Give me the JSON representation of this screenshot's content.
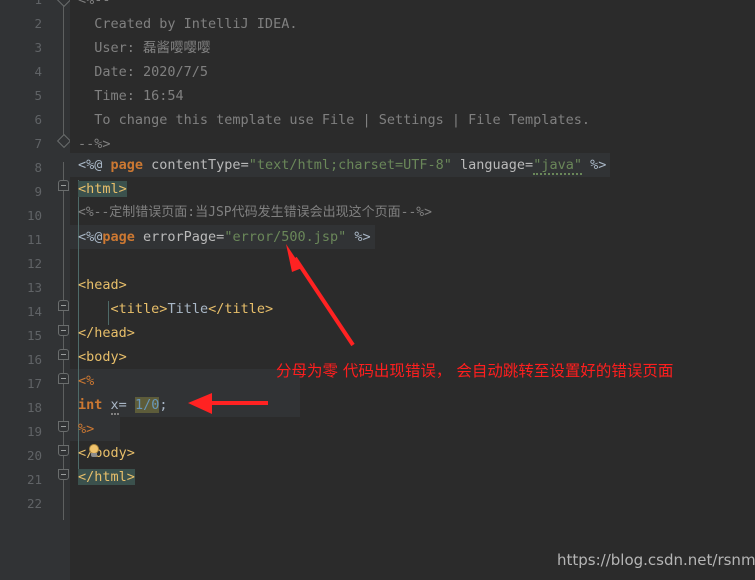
{
  "editor": {
    "app": "IntelliJ IDEA",
    "language": "jsp",
    "theme": "Darcula",
    "colors": {
      "background": "#2b2b2b",
      "gutter_background": "#313335",
      "line_number": "#606366",
      "comment": "#808080",
      "tag": "#e8bf6a",
      "keyword": "#cc7832",
      "string": "#6a8759",
      "number": "#6897bb",
      "default_text": "#a9b7c6",
      "match_highlight": "#3b514d",
      "value_highlight": "#5d5c3a",
      "annotation_red": "#ff1e1e",
      "indent_guide": "#4e6a68"
    },
    "line_numbers": [
      1,
      2,
      3,
      4,
      5,
      6,
      7,
      8,
      9,
      10,
      11,
      12,
      13,
      14,
      15,
      16,
      17,
      18,
      19,
      20,
      21,
      22
    ],
    "lines": [
      {
        "n": 1,
        "text": "<%--"
      },
      {
        "n": 2,
        "text": "  Created by IntelliJ IDEA."
      },
      {
        "n": 3,
        "text": "  User: 磊酱嘤嘤嘤"
      },
      {
        "n": 4,
        "text": "  Date: 2020/7/5"
      },
      {
        "n": 5,
        "text": "  Time: 16:54"
      },
      {
        "n": 6,
        "text": "  To change this template use File | Settings | File Templates."
      },
      {
        "n": 7,
        "text": "--%>"
      },
      {
        "n": 8,
        "text": "<%@ page contentType=\"text/html;charset=UTF-8\" language=\"java\" %>"
      },
      {
        "n": 9,
        "text": "<html>"
      },
      {
        "n": 10,
        "text": "<%--定制错误页面:当JSP代码发生错误会出现这个页面--%>"
      },
      {
        "n": 11,
        "text": "<%@page errorPage=\"error/500.jsp\" %>"
      },
      {
        "n": 12,
        "text": ""
      },
      {
        "n": 13,
        "text": "<head>"
      },
      {
        "n": 14,
        "text": "    <title>Title</title>"
      },
      {
        "n": 15,
        "text": "</head>"
      },
      {
        "n": 16,
        "text": "<body>"
      },
      {
        "n": 17,
        "text": "<%"
      },
      {
        "n": 18,
        "text": "int x= 1/0;"
      },
      {
        "n": 19,
        "text": "%>"
      },
      {
        "n": 20,
        "text": "</body>"
      },
      {
        "n": 21,
        "text": "</html>"
      },
      {
        "n": 22,
        "text": ""
      }
    ],
    "tokens": {
      "l1_comment": "<%--",
      "l2_comment": "  Created by IntelliJ IDEA.",
      "l3_comment": "  User: 磊酱嘤嘤嘤",
      "l4_comment": "  Date: 2020/7/5",
      "l5_comment": "  Time: 16:54",
      "l6_comment": "  To change this template use File | Settings | File Templates.",
      "l7_comment": "--%>",
      "l8_open": "<%@ ",
      "l8_kw": "page",
      "l8_attr1": " contentType=",
      "l8_str1": "\"text/html;charset=UTF-8\"",
      "l8_attr2": " language=",
      "l8_str2": "\"java\"",
      "l8_close": " %>",
      "l9_lt": "<",
      "l9_name": "html",
      "l9_gt": ">",
      "l10_comment": "<%--定制错误页面:当JSP代码发生错误会出现这个页面--%>",
      "l11_open": "<%@",
      "l11_kw": "page",
      "l11_attr": " errorPage=",
      "l11_str": "\"error/500.jsp\"",
      "l11_close": " %>",
      "l13_lt": "<",
      "l13_name": "head",
      "l13_gt": ">",
      "l14_indent": "    ",
      "l14_lt": "<",
      "l14_name": "title",
      "l14_gt": ">",
      "l14_text": "Title",
      "l14_close": "</title>",
      "l15": "</head>",
      "l16": "<body>",
      "l17": "<%",
      "l18_kw": "int",
      "l18_sp": " ",
      "l18_var": "x",
      "l18_eq": "= ",
      "l18_val": "1/0",
      "l18_semi": ";",
      "l19": "%>",
      "l20_a": "</",
      "l20_b": "body",
      "l20_c": ">",
      "l21_lt": "</",
      "l21_name": "html",
      "l21_gt": ">"
    }
  },
  "annotations": {
    "note_text": "分母为零 代码出现错误， 会自动跳转至设置好的错误页面",
    "arrow_to_errorpage": "red-arrow-diagonal",
    "arrow_to_division": "red-arrow-left"
  },
  "watermark": {
    "url": "https://blog.csdn.net/rsnmd"
  }
}
